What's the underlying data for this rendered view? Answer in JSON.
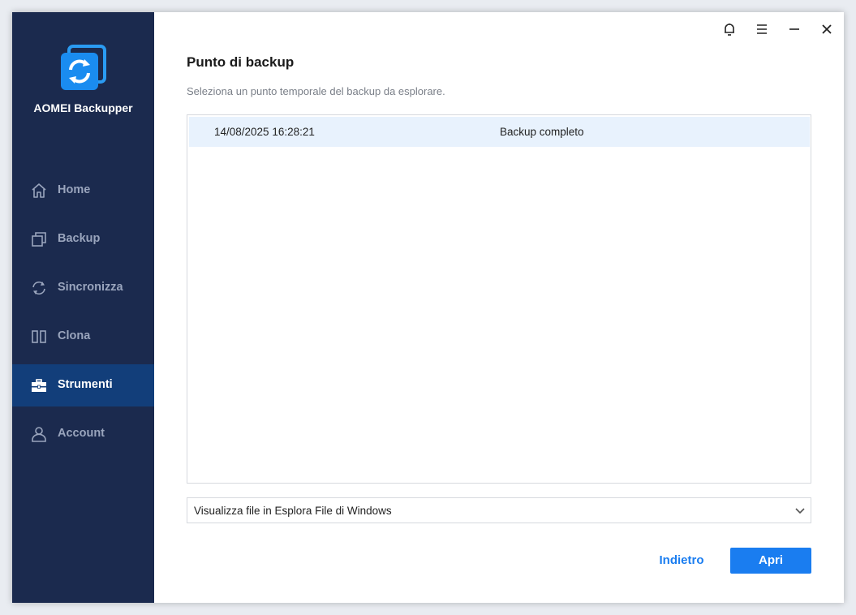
{
  "app": {
    "name": "AOMEI Backupper"
  },
  "sidebar": {
    "items": [
      {
        "label": "Home",
        "icon": "home-icon"
      },
      {
        "label": "Backup",
        "icon": "backup-icon"
      },
      {
        "label": "Sincronizza",
        "icon": "sync-icon"
      },
      {
        "label": "Clona",
        "icon": "clone-icon"
      },
      {
        "label": "Strumenti",
        "icon": "toolbox-icon",
        "active": true
      },
      {
        "label": "Account",
        "icon": "user-icon"
      }
    ]
  },
  "titlebar": {
    "icons": [
      "bell-icon",
      "menu-icon",
      "minimize-icon",
      "close-icon"
    ]
  },
  "main": {
    "title": "Punto di backup",
    "subtitle": "Seleziona un punto temporale del backup da esplorare.",
    "backup_points": [
      {
        "date": "14/08/2025 16:28:21",
        "type": "Backup completo",
        "selected": true
      }
    ],
    "view_select": {
      "value": "Visualizza file in Esplora File di Windows"
    },
    "buttons": {
      "back": "Indietro",
      "open": "Apri"
    }
  },
  "colors": {
    "sidebar_bg": "#1b2a4e",
    "sidebar_active": "#123e7a",
    "accent": "#1a7df0",
    "row_selected": "#e8f2fd"
  }
}
